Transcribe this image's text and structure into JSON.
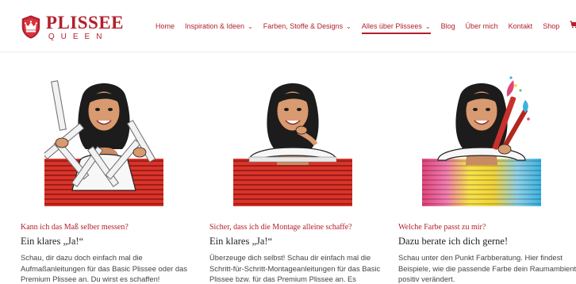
{
  "brand": {
    "name": "PLISSEE",
    "sub": "QUEEN",
    "color": "#b21f2d"
  },
  "nav": {
    "items": [
      {
        "label": "Home",
        "dropdown": false,
        "active": false
      },
      {
        "label": "Inspiration & Ideen",
        "dropdown": true,
        "active": false
      },
      {
        "label": "Farben, Stoffe & Designs",
        "dropdown": true,
        "active": false
      },
      {
        "label": "Alles über Plissees",
        "dropdown": true,
        "active": true
      },
      {
        "label": "Blog",
        "dropdown": false,
        "active": false
      },
      {
        "label": "Über mich",
        "dropdown": false,
        "active": false
      },
      {
        "label": "Kontakt",
        "dropdown": false,
        "active": false
      },
      {
        "label": "Shop",
        "dropdown": false,
        "active": false
      }
    ],
    "cart_icon": "cart-icon"
  },
  "cards": [
    {
      "illustration": "woman-with-folding-ruler",
      "kicker": "Kann ich das Maß selber messen?",
      "heading": "Ein klares „Ja!“",
      "body": "Schau, dir dazu doch einfach mal die Aufmaßanleitungen für das Basic Plissee oder das Premium Plissee an. Du wirst es schaffen!"
    },
    {
      "illustration": "woman-leaning-on-plissee",
      "kicker": "Sicher, dass ich die Montage alleine schaffe?",
      "heading": "Ein klares „Ja!“",
      "body": "Überzeuge dich selbst! Schau dir einfach mal die Schritt-für-Schritt-Montageanleitungen für das Basic Plissee bzw. für das Premium Plissee an. Es"
    },
    {
      "illustration": "woman-with-paintbrushes",
      "kicker": "Welche Farbe passt zu mir?",
      "heading": "Dazu berate ich dich gerne!",
      "body": "Schau unter den Punkt Farbberatung. Hier findest Beispiele, wie die passende Farbe dein Raumambiente positiv verändert."
    }
  ]
}
